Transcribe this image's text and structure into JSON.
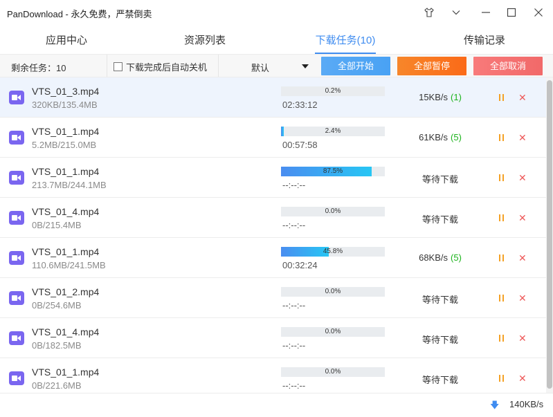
{
  "window": {
    "title": "PanDownload - 永久免费，严禁倒卖",
    "controls": [
      "shirt-icon",
      "chevron-down-icon",
      "minimize-icon",
      "maximize-icon",
      "close-icon"
    ]
  },
  "tabs": [
    {
      "label": "应用中心",
      "active": false
    },
    {
      "label": "资源列表",
      "active": false
    },
    {
      "label": "下载任务(10)",
      "active": true
    },
    {
      "label": "传输记录",
      "active": false
    }
  ],
  "toolbar": {
    "remaining": "剩余任务：10",
    "auto_shutdown_label": "下载完成后自动关机",
    "auto_shutdown_checked": false,
    "sort_value": "默认",
    "start_all": "全部开始",
    "pause_all": "全部暂停",
    "cancel_all": "全部取消"
  },
  "tasks": [
    {
      "name": "VTS_01_3.mp4",
      "size": "320KB/135.4MB",
      "progress_text": "0.2%",
      "progress": 0.2,
      "eta": "02:33:12",
      "status": "15KB/s",
      "threads": "(1)",
      "selected": true
    },
    {
      "name": "VTS_01_1.mp4",
      "size": "5.2MB/215.0MB",
      "progress_text": "2.4%",
      "progress": 2.4,
      "eta": "00:57:58",
      "status": "61KB/s",
      "threads": "(5)",
      "selected": false
    },
    {
      "name": "VTS_01_1.mp4",
      "size": "213.7MB/244.1MB",
      "progress_text": "87.5%",
      "progress": 87.5,
      "eta": "--:--:--",
      "status": "等待下载",
      "threads": "",
      "selected": false
    },
    {
      "name": "VTS_01_4.mp4",
      "size": "0B/215.4MB",
      "progress_text": "0.0%",
      "progress": 0.0,
      "eta": "--:--:--",
      "status": "等待下载",
      "threads": "",
      "selected": false
    },
    {
      "name": "VTS_01_1.mp4",
      "size": "110.6MB/241.5MB",
      "progress_text": "45.8%",
      "progress": 45.8,
      "eta": "00:32:24",
      "status": "68KB/s",
      "threads": "(5)",
      "selected": false
    },
    {
      "name": "VTS_01_2.mp4",
      "size": "0B/254.6MB",
      "progress_text": "0.0%",
      "progress": 0.0,
      "eta": "--:--:--",
      "status": "等待下载",
      "threads": "",
      "selected": false
    },
    {
      "name": "VTS_01_4.mp4",
      "size": "0B/182.5MB",
      "progress_text": "0.0%",
      "progress": 0.0,
      "eta": "--:--:--",
      "status": "等待下载",
      "threads": "",
      "selected": false
    },
    {
      "name": "VTS_01_1.mp4",
      "size": "0B/221.6MB",
      "progress_text": "0.0%",
      "progress": 0.0,
      "eta": "--:--:--",
      "status": "等待下载",
      "threads": "",
      "selected": false
    }
  ],
  "statusbar": {
    "total_speed": "140KB/s",
    "icon": "download-arrow-icon"
  },
  "colors": {
    "accent": "#3f8cf0",
    "pause_orange": "#fb6a18",
    "cancel_red": "#f16969",
    "thread_green": "#1bb31b",
    "video_icon": "#7a66f0"
  }
}
